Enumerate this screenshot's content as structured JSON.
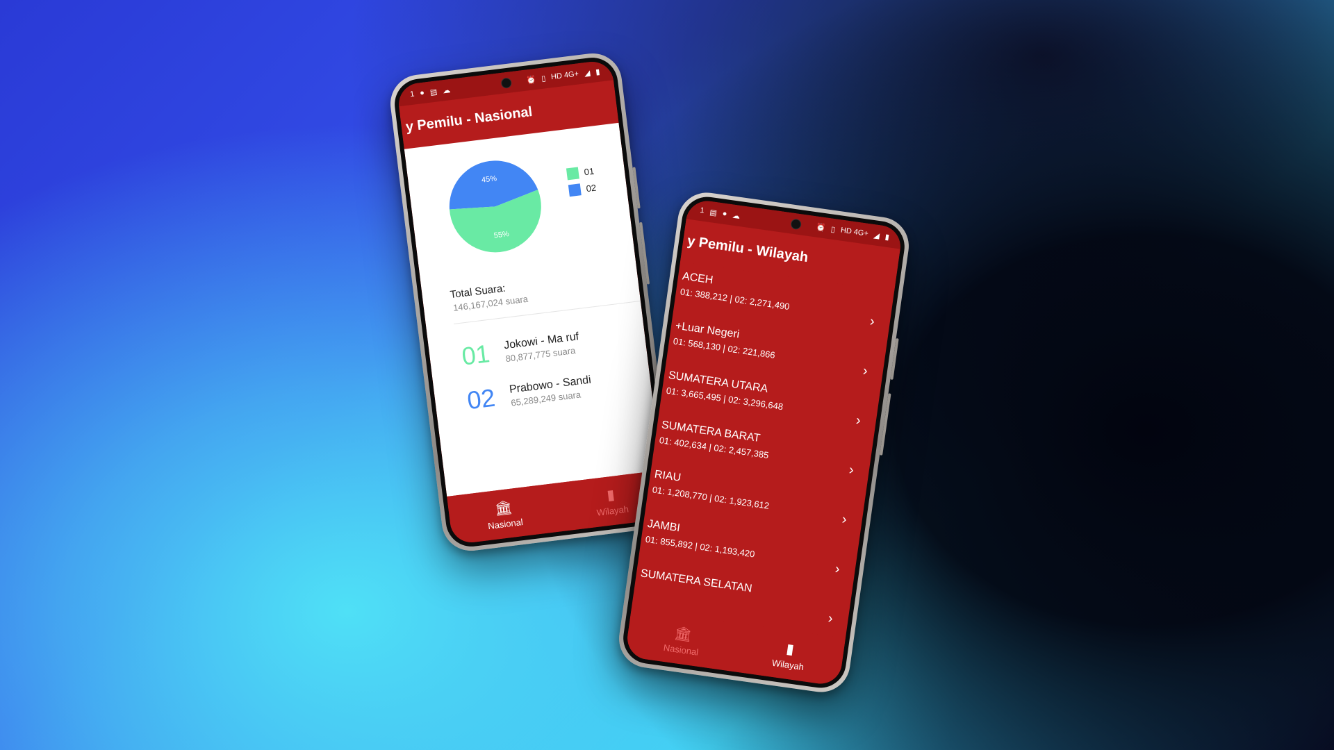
{
  "status_bar": {
    "time_glyph": "1",
    "network": "HD 4G+"
  },
  "national": {
    "app_title": "y Pemilu - Nasional",
    "chart_data": {
      "type": "pie",
      "slices": [
        {
          "label": "01",
          "value": 55,
          "display": "55%",
          "color": "#69eaa4"
        },
        {
          "label": "02",
          "value": 45,
          "display": "45%",
          "color": "#4286f4"
        }
      ]
    },
    "legend": [
      {
        "label": "01",
        "color": "#69eaa4"
      },
      {
        "label": "02",
        "color": "#4286f4"
      }
    ],
    "total_label": "Total Suara:",
    "total_value": "146,167,024 suara",
    "candidates": [
      {
        "number": "01",
        "name": "Jokowi - Ma ruf",
        "votes": "80,877,775 suara",
        "color": "#69eaa4"
      },
      {
        "number": "02",
        "name": "Prabowo - Sandi",
        "votes": "65,289,249 suara",
        "color": "#4286f4"
      }
    ]
  },
  "regional": {
    "app_title": "y Pemilu - Wilayah",
    "regions": [
      {
        "name": "ACEH",
        "votes": "01: 388,212 | 02: 2,271,490"
      },
      {
        "name": "+Luar Negeri",
        "votes": "01: 568,130 | 02: 221,866"
      },
      {
        "name": "SUMATERA UTARA",
        "votes": "01: 3,665,495 | 02: 3,296,648"
      },
      {
        "name": "SUMATERA BARAT",
        "votes": "01: 402,634 | 02: 2,457,385"
      },
      {
        "name": "RIAU",
        "votes": "01: 1,208,770 | 02: 1,923,612"
      },
      {
        "name": "JAMBI",
        "votes": "01: 855,892 | 02: 1,193,420"
      },
      {
        "name": "SUMATERA SELATAN",
        "votes": ""
      }
    ]
  },
  "nav": {
    "national_label": "Nasional",
    "regional_label": "Wilayah"
  },
  "colors": {
    "primary": "#b51c1c",
    "status": "#9b1414",
    "green": "#69eaa4",
    "blue": "#4286f4"
  }
}
